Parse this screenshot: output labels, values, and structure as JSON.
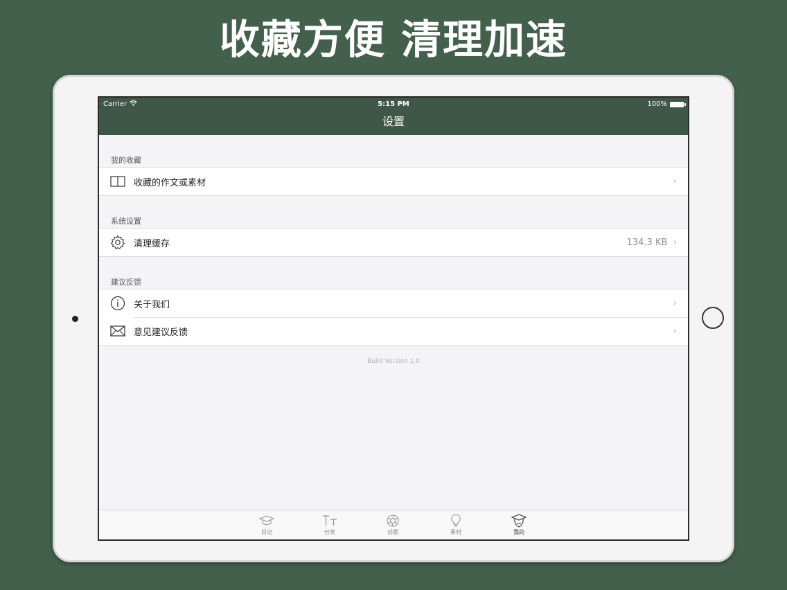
{
  "headline": "收藏方便 清理加速",
  "status": {
    "carrier": "Carrier",
    "time": "5:15 PM",
    "battery": "100%"
  },
  "nav": {
    "title": "设置"
  },
  "sections": [
    {
      "header": "我的收藏",
      "rows": [
        {
          "label": "收藏的作文或素材",
          "icon": "book-icon"
        }
      ]
    },
    {
      "header": "系统设置",
      "rows": [
        {
          "label": "清理缓存",
          "detail": "134.3 KB",
          "icon": "gear-icon"
        }
      ]
    },
    {
      "header": "建议反馈",
      "rows": [
        {
          "label": "关于我们",
          "icon": "info-icon"
        },
        {
          "label": "意见建议反馈",
          "icon": "envelope-icon"
        }
      ]
    }
  ],
  "footer": "Build Version 1.0",
  "tabs": [
    {
      "label": "日记",
      "icon": "graduation-cap-icon"
    },
    {
      "label": "分类",
      "icon": "text-size-icon"
    },
    {
      "label": "话题",
      "icon": "aperture-icon"
    },
    {
      "label": "素材",
      "icon": "lightbulb-icon"
    },
    {
      "label": "我的",
      "icon": "graduate-avatar-icon",
      "active": true
    }
  ],
  "chevron": "›",
  "colors": {
    "background": "#43604c",
    "navbar": "#3f5746"
  }
}
